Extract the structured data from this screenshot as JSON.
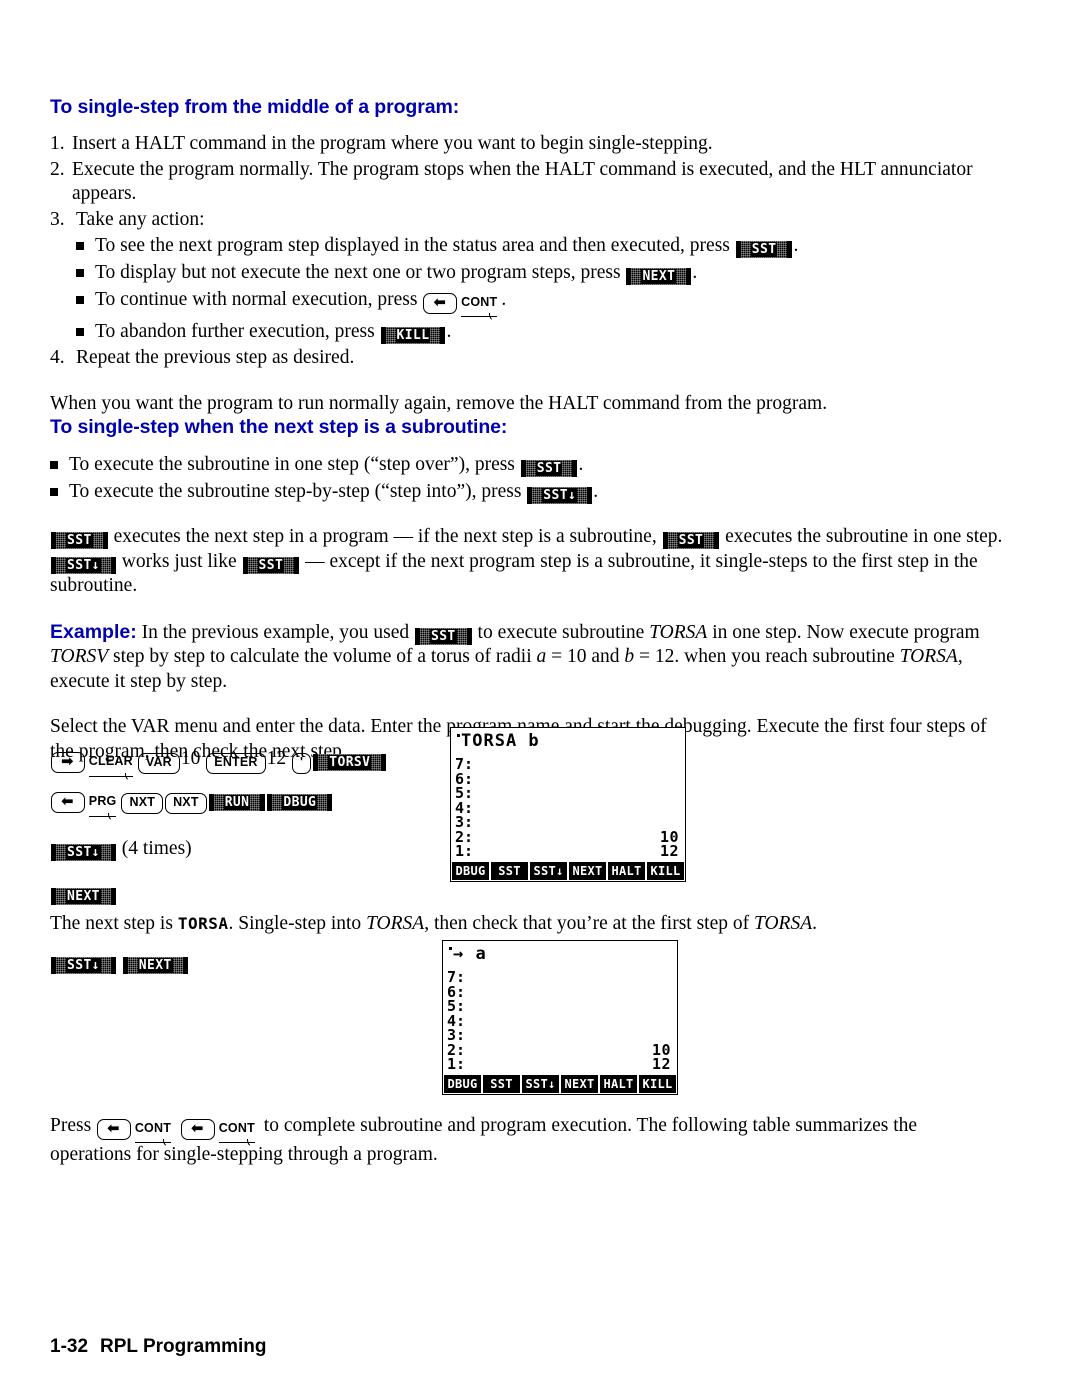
{
  "section1": {
    "heading": "To single-step from the middle of a program:",
    "steps": [
      {
        "num": "1.",
        "text_before": "Insert a HALT command in the program where you want to begin single-stepping."
      },
      {
        "num": "2.",
        "text_before": "Execute the program normally. The program stops when the HALT command is executed, and the HLT annunciator appears."
      },
      {
        "num": "3.",
        "text_before": "Take any action:"
      }
    ],
    "sub_bullets": [
      {
        "text_before": "To see the next program step displayed in the status area and then executed, press ",
        "key": "SST",
        "text_after": "."
      },
      {
        "text_before": "To display but not execute the next one or two program steps, press ",
        "key": "NEXT",
        "text_after": "."
      },
      {
        "text_before": "To continue with normal execution, press ",
        "shift": "left",
        "shift_label": "CONT",
        "text_after": "."
      },
      {
        "text_before": "To abandon further execution, press ",
        "key": "KILL",
        "text_after": "."
      }
    ],
    "step4": {
      "num": "4.",
      "text": "Repeat the previous step as desired."
    },
    "closing_para": "When you want the program to run normally again, remove the HALT command from the program."
  },
  "section2": {
    "heading": "To single-step when the next step is a subroutine:",
    "bullets": [
      {
        "text_before": "To execute the subroutine in one step (“step over”), press ",
        "key": "SST",
        "text_after": "."
      },
      {
        "text_before": "To execute the subroutine step-by-step (“step into”), press ",
        "key": "SST↓",
        "text_after": "."
      }
    ],
    "explain": {
      "k1": "SST",
      "p1": " executes the next step in a program — if the next step is a subroutine, ",
      "k2": "SST",
      "p2": " executes the subroutine in one step. ",
      "k3": "SST↓",
      "p3": " works just like ",
      "k4": "SST",
      "p4": " — except if the next program step is a subroutine, it single-steps to the first step in the subroutine."
    },
    "example": {
      "label": "Example:",
      "t1": " In the previous example, you used ",
      "key": "SST",
      "t2": " to execute subroutine ",
      "prog1": "TORSA",
      "t3": " in one step. Now execute program ",
      "prog2": "TORSV",
      "t4": " step by step to calculate the volume of a torus of radii ",
      "var_a": "a",
      "t5": " = 10 and ",
      "var_b": "b",
      "t6": " = 12. when you reach subroutine ",
      "prog3": "TORSA",
      "t7": ", execute it step by step."
    },
    "instruction_para": "Select the VAR menu and enter the data. Enter the program name and start the debugging. Execute the first four steps of the program, then check the next step."
  },
  "keystrokes": {
    "row1": {
      "shift": "right",
      "shift_label": "CLEAR",
      "key_var": "VAR",
      "num1": "10",
      "key_enter": "ENTER",
      "num2": "12",
      "key_tick": "'",
      "menu_key": "TORSV"
    },
    "row2": {
      "shift": "left",
      "shift_label": "PRG",
      "key_nxt1": "NXT",
      "key_nxt2": "NXT",
      "menu_run": "RUN",
      "menu_dbug": "DBUG"
    },
    "row3": {
      "menu_key": "SST↓",
      "note": "(4 times)"
    },
    "row4": {
      "menu_key": "NEXT"
    },
    "row5": {
      "menu_key1": "SST↓",
      "menu_key2": "NEXT"
    }
  },
  "lcd1": {
    "header": "TORSA b",
    "rows": [
      {
        "label": "7:",
        "value": ""
      },
      {
        "label": "6:",
        "value": ""
      },
      {
        "label": "5:",
        "value": ""
      },
      {
        "label": "4:",
        "value": ""
      },
      {
        "label": "3:",
        "value": ""
      },
      {
        "label": "2:",
        "value": "10"
      },
      {
        "label": "1:",
        "value": "12"
      }
    ],
    "menu": [
      "DBUG",
      "SST",
      "SST↓",
      "NEXT",
      "HALT",
      "KILL"
    ]
  },
  "lcd2": {
    "header": "→ a",
    "rows": [
      {
        "label": "7:",
        "value": ""
      },
      {
        "label": "6:",
        "value": ""
      },
      {
        "label": "5:",
        "value": ""
      },
      {
        "label": "4:",
        "value": ""
      },
      {
        "label": "3:",
        "value": ""
      },
      {
        "label": "2:",
        "value": "10"
      },
      {
        "label": "1:",
        "value": "12"
      }
    ],
    "menu": [
      "DBUG",
      "SST",
      "SST↓",
      "NEXT",
      "HALT",
      "KILL"
    ]
  },
  "next_step_para": {
    "t1": "The next step is ",
    "lcd_name": "TORSA",
    "t2": ". Single-step into ",
    "prog1": "TORSA",
    "t3": ", then check that you’re at the first step of ",
    "prog2": "TORSA",
    "t4": "."
  },
  "press_cont_para": {
    "t1": "Press ",
    "shift1_label": "CONT",
    "shift2_label": "CONT",
    "t2": " to complete subroutine and program execution. The following table summarizes the operations for single-stepping through a program."
  },
  "footer": {
    "page": "1-32",
    "title": "RPL Programming"
  }
}
